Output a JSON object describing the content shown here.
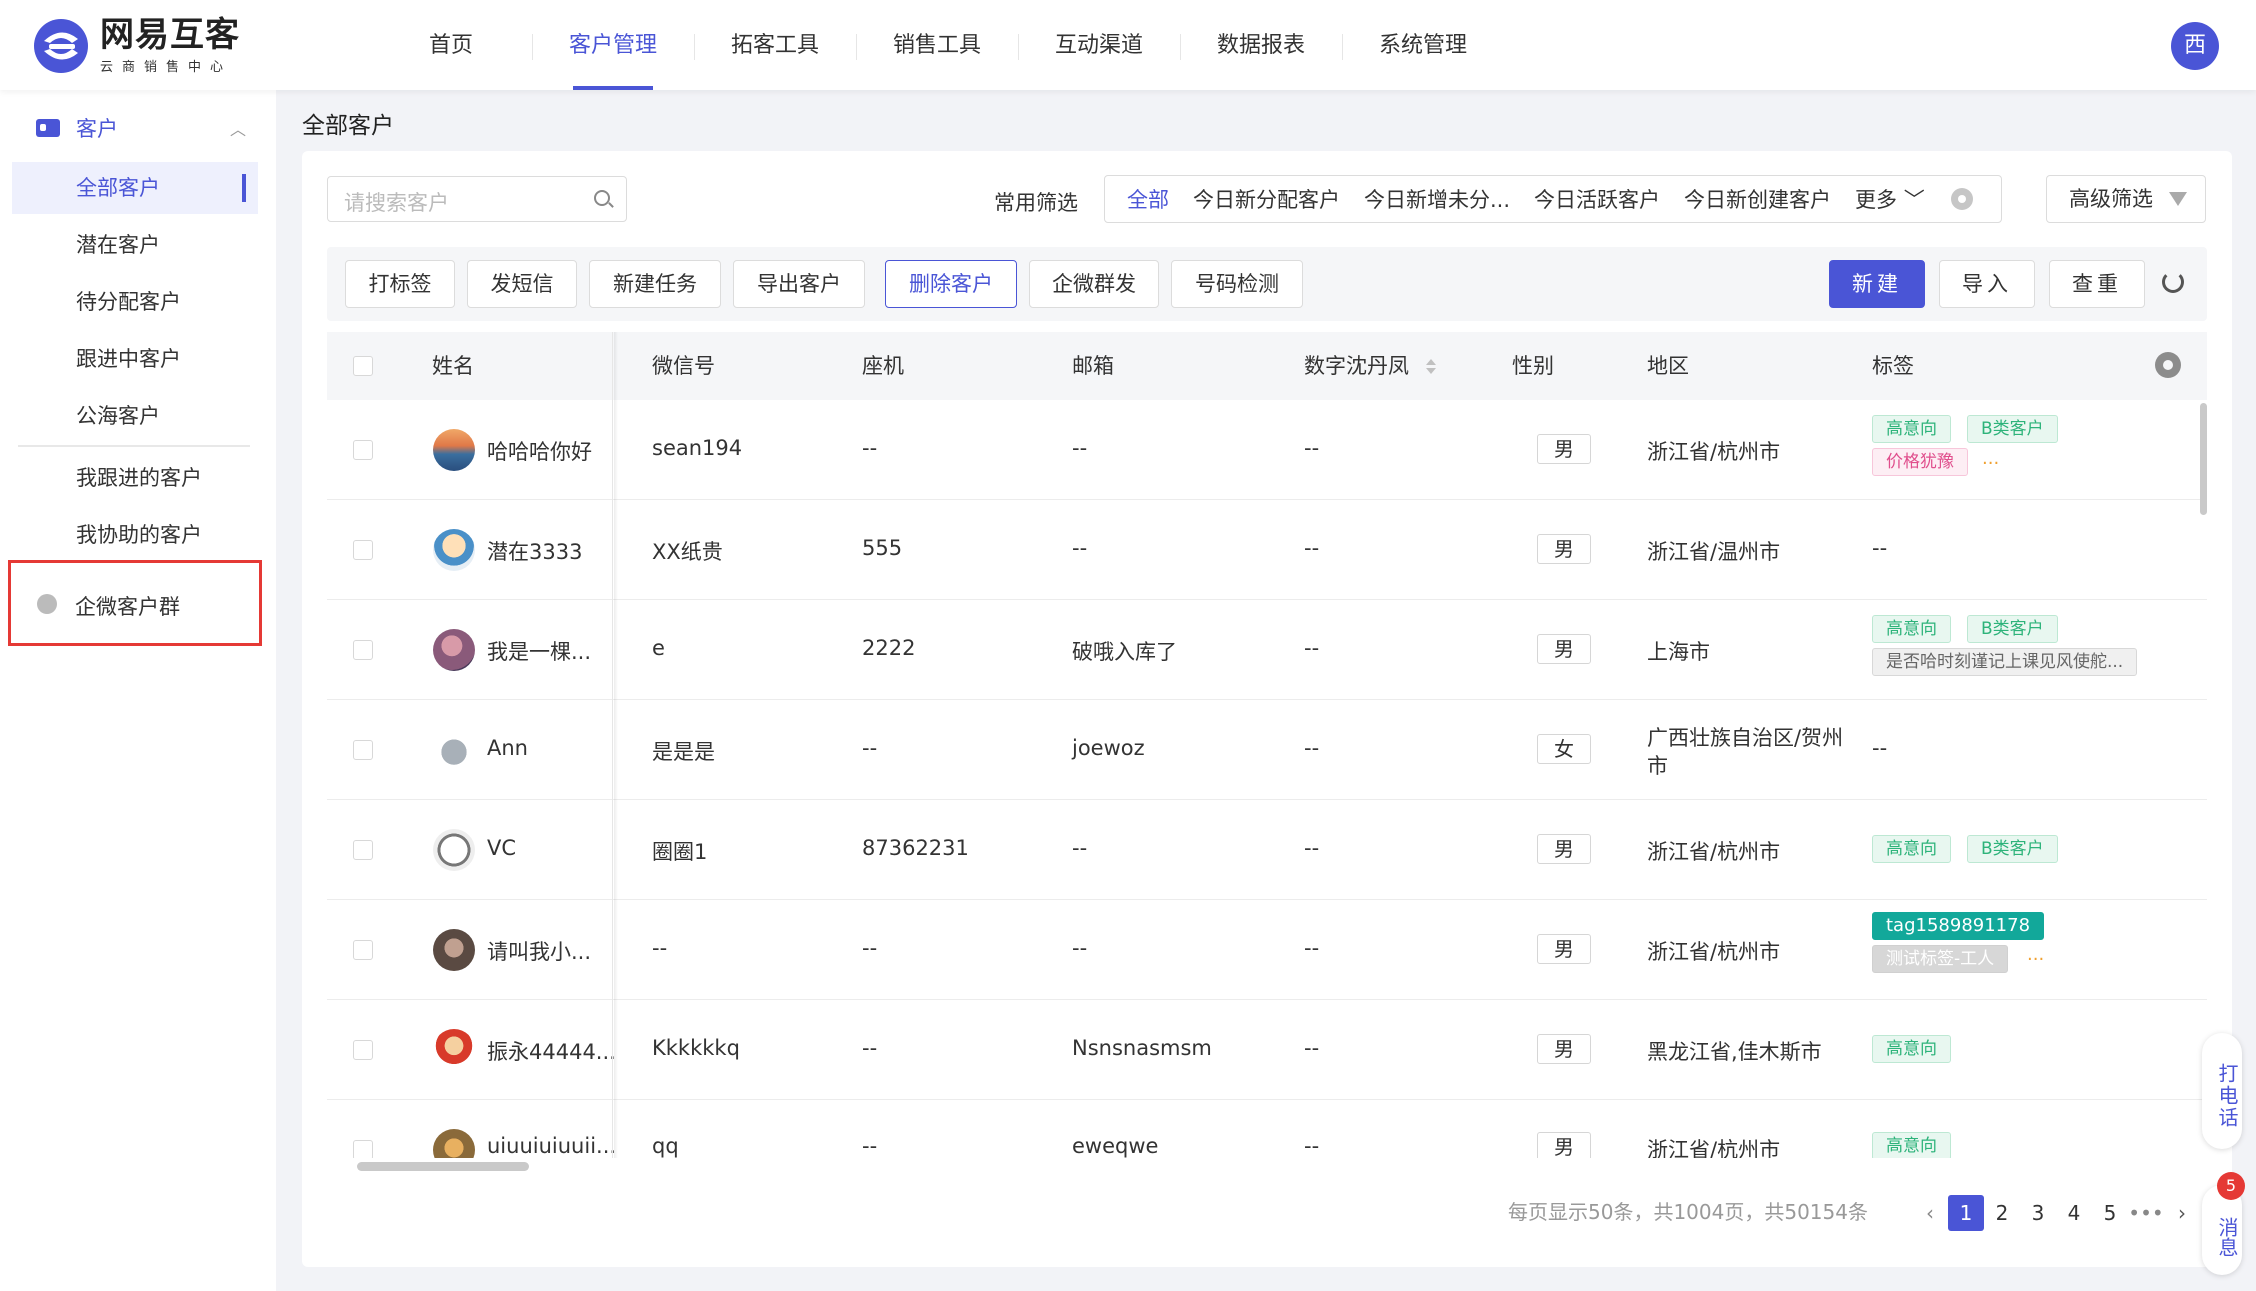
{
  "brand": {
    "title": "网易互客",
    "subtitle": "云商销售中心"
  },
  "nav": [
    {
      "label": "首页"
    },
    {
      "label": "客户管理",
      "active": true
    },
    {
      "label": "拓客工具"
    },
    {
      "label": "销售工具"
    },
    {
      "label": "互动渠道"
    },
    {
      "label": "数据报表"
    },
    {
      "label": "系统管理"
    }
  ],
  "user": {
    "avatar_text": "西"
  },
  "sidebar": {
    "section": "客户",
    "items": [
      "全部客户",
      "潜在客户",
      "待分配客户",
      "跟进中客户",
      "公海客户",
      "我跟进的客户",
      "我协助的客户"
    ],
    "group": "企微客户群"
  },
  "page": {
    "title": "全部客户"
  },
  "search": {
    "placeholder": "请搜索客户"
  },
  "filters": {
    "label": "常用筛选",
    "items": [
      "全部",
      "今日新分配客户",
      "今日新增未分...",
      "今日活跃客户",
      "今日新创建客户",
      "更多"
    ],
    "advanced": "高级筛选"
  },
  "toolbar": {
    "actions": [
      "打标签",
      "发短信",
      "新建任务",
      "导出客户",
      "删除客户",
      "企微群发",
      "号码检测"
    ],
    "new": "新建",
    "import": "导入",
    "dedupe": "查重"
  },
  "table": {
    "columns": [
      "姓名",
      "微信号",
      "座机",
      "邮箱",
      "数字沈丹凤",
      "性别",
      "地区",
      "标签"
    ],
    "rows": [
      {
        "name": "哈哈哈你好",
        "wechat": "sean194",
        "phone": "--",
        "email": "--",
        "custom": "--",
        "gender": "男",
        "region": "浙江省/杭州市",
        "region2": "",
        "tags": [
          "高意向",
          "B类客户",
          "价格犹豫"
        ],
        "more": "..."
      },
      {
        "name": "潜在3333",
        "wechat": "XX纸贵",
        "phone": "555",
        "email": "--",
        "custom": "--",
        "gender": "男",
        "region": "浙江省/温州市",
        "region2": "",
        "tags_text": "--"
      },
      {
        "name": "我是一棵...",
        "wechat": "e",
        "phone": "2222",
        "email": "破哦入库了",
        "custom": "--",
        "gender": "男",
        "region": "上海市",
        "region2": "",
        "tags": [
          "高意向",
          "B类客户",
          "是否哈时刻谨记上课见风使舵..."
        ]
      },
      {
        "name": "Ann",
        "wechat": "是是是",
        "phone": "--",
        "email": "joewoz",
        "custom": "--",
        "gender": "女",
        "region": "广西壮族自治区/贺州",
        "region2": "市",
        "tags_text": "--"
      },
      {
        "name": "VC",
        "wechat": "圈圈1",
        "phone": "87362231",
        "email": "--",
        "custom": "--",
        "gender": "男",
        "region": "浙江省/杭州市",
        "region2": "",
        "tags": [
          "高意向",
          "B类客户"
        ]
      },
      {
        "name": "请叫我小...",
        "wechat": "--",
        "phone": "--",
        "email": "--",
        "custom": "--",
        "gender": "男",
        "region": "浙江省/杭州市",
        "region2": "",
        "tags": [
          "tag1589891178",
          "测试标签-工人"
        ],
        "more": "..."
      },
      {
        "name": "振永44444...",
        "wechat": "Kkkkkkq",
        "phone": "--",
        "email": "Nsnsnasmsm",
        "custom": "--",
        "gender": "男",
        "region": "黑龙江省,佳木斯市",
        "region2": "",
        "tags": [
          "高意向"
        ]
      },
      {
        "name": "uiuuiuiuuii...",
        "wechat": "qq",
        "phone": "--",
        "email": "eweqwe",
        "custom": "--",
        "gender": "男",
        "region": "浙江省/杭州市",
        "region2": "",
        "tags": [
          "高意向"
        ]
      }
    ]
  },
  "pagination": {
    "summary": "每页显示50条，共1004页，共50154条",
    "pages": [
      "1",
      "2",
      "3",
      "4",
      "5"
    ],
    "current": "1",
    "ellipsis": "•••"
  },
  "floating": {
    "call": "打电话",
    "message": "消息",
    "badge": "5"
  }
}
